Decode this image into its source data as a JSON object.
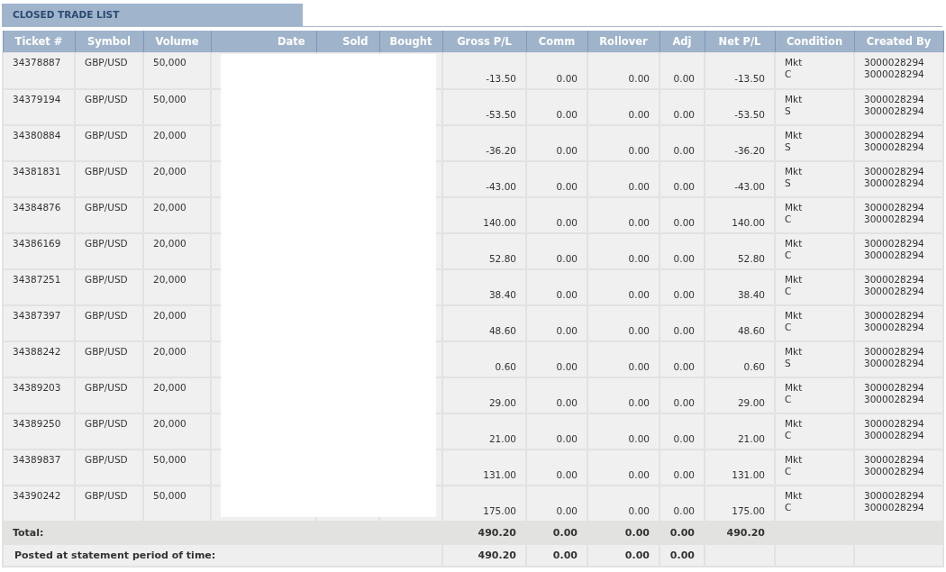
{
  "title": "CLOSED TRADE LIST",
  "columns": [
    "Ticket #",
    "Symbol",
    "Volume",
    "Date",
    "Sold",
    "Bought",
    "Gross P/L",
    "Comm",
    "Rollover",
    "Adj",
    "Net P/L",
    "Condition",
    "Created By"
  ],
  "rows": [
    {
      "ticket": "34378887",
      "symbol": "GBP/USD",
      "volume": "50,000",
      "gross": "-13.50",
      "comm": "0.00",
      "rollover": "0.00",
      "adj": "0.00",
      "net": "-13.50",
      "condition": "Mkt\nC",
      "created_by": "3000028294\n3000028294"
    },
    {
      "ticket": "34379194",
      "symbol": "GBP/USD",
      "volume": "50,000",
      "gross": "-53.50",
      "comm": "0.00",
      "rollover": "0.00",
      "adj": "0.00",
      "net": "-53.50",
      "condition": "Mkt\nS",
      "created_by": "3000028294\n3000028294"
    },
    {
      "ticket": "34380884",
      "symbol": "GBP/USD",
      "volume": "20,000",
      "gross": "-36.20",
      "comm": "0.00",
      "rollover": "0.00",
      "adj": "0.00",
      "net": "-36.20",
      "condition": "Mkt\nS",
      "created_by": "3000028294\n3000028294"
    },
    {
      "ticket": "34381831",
      "symbol": "GBP/USD",
      "volume": "20,000",
      "gross": "-43.00",
      "comm": "0.00",
      "rollover": "0.00",
      "adj": "0.00",
      "net": "-43.00",
      "condition": "Mkt\nS",
      "created_by": "3000028294\n3000028294"
    },
    {
      "ticket": "34384876",
      "symbol": "GBP/USD",
      "volume": "20,000",
      "gross": "140.00",
      "comm": "0.00",
      "rollover": "0.00",
      "adj": "0.00",
      "net": "140.00",
      "condition": "Mkt\nC",
      "created_by": "3000028294\n3000028294"
    },
    {
      "ticket": "34386169",
      "symbol": "GBP/USD",
      "volume": "20,000",
      "gross": "52.80",
      "comm": "0.00",
      "rollover": "0.00",
      "adj": "0.00",
      "net": "52.80",
      "condition": "Mkt\nC",
      "created_by": "3000028294\n3000028294"
    },
    {
      "ticket": "34387251",
      "symbol": "GBP/USD",
      "volume": "20,000",
      "gross": "38.40",
      "comm": "0.00",
      "rollover": "0.00",
      "adj": "0.00",
      "net": "38.40",
      "condition": "Mkt\nC",
      "created_by": "3000028294\n3000028294"
    },
    {
      "ticket": "34387397",
      "symbol": "GBP/USD",
      "volume": "20,000",
      "gross": "48.60",
      "comm": "0.00",
      "rollover": "0.00",
      "adj": "0.00",
      "net": "48.60",
      "condition": "Mkt\nC",
      "created_by": "3000028294\n3000028294"
    },
    {
      "ticket": "34388242",
      "symbol": "GBP/USD",
      "volume": "20,000",
      "gross": "0.60",
      "comm": "0.00",
      "rollover": "0.00",
      "adj": "0.00",
      "net": "0.60",
      "condition": "Mkt\nS",
      "created_by": "3000028294\n3000028294"
    },
    {
      "ticket": "34389203",
      "symbol": "GBP/USD",
      "volume": "20,000",
      "gross": "29.00",
      "comm": "0.00",
      "rollover": "0.00",
      "adj": "0.00",
      "net": "29.00",
      "condition": "Mkt\nC",
      "created_by": "3000028294\n3000028294"
    },
    {
      "ticket": "34389250",
      "symbol": "GBP/USD",
      "volume": "20,000",
      "gross": "21.00",
      "comm": "0.00",
      "rollover": "0.00",
      "adj": "0.00",
      "net": "21.00",
      "condition": "Mkt\nC",
      "created_by": "3000028294\n3000028294"
    },
    {
      "ticket": "34389837",
      "symbol": "GBP/USD",
      "volume": "50,000",
      "gross": "131.00",
      "comm": "0.00",
      "rollover": "0.00",
      "adj": "0.00",
      "net": "131.00",
      "condition": "Mkt\nC",
      "created_by": "3000028294\n3000028294"
    },
    {
      "ticket": "34390242",
      "symbol": "GBP/USD",
      "volume": "50,000",
      "gross": "175.00",
      "comm": "0.00",
      "rollover": "0.00",
      "adj": "0.00",
      "net": "175.00",
      "condition": "Mkt\nC",
      "created_by": "3000028294\n3000028294"
    }
  ],
  "summary": [
    {
      "kind": "total",
      "label": "Total:",
      "gross": "490.20",
      "comm": "0.00",
      "rollover": "0.00",
      "adj": "0.00",
      "net": "490.20"
    },
    {
      "kind": "posted",
      "label": "Posted at statement period of time:",
      "gross": "490.20",
      "comm": "0.00",
      "rollover": "0.00",
      "adj": "0.00"
    }
  ]
}
